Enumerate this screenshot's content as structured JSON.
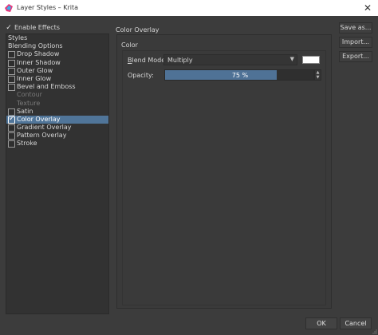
{
  "window": {
    "title": "Layer Styles – Krita",
    "icons": [
      "krita-app-icon",
      "close-icon"
    ]
  },
  "enable_effects": {
    "label": "Enable Effects",
    "checked": true
  },
  "styles_list": {
    "header": "Styles",
    "blending_options": "Blending Options",
    "items": [
      {
        "label": "Drop Shadow",
        "checked": false,
        "selected": false
      },
      {
        "label": "Inner Shadow",
        "checked": false,
        "selected": false
      },
      {
        "label": "Outer Glow",
        "checked": false,
        "selected": false
      },
      {
        "label": "Inner Glow",
        "checked": false,
        "selected": false
      },
      {
        "label": "Bevel and Emboss",
        "checked": false,
        "selected": false
      },
      {
        "label": "Contour",
        "sub": true
      },
      {
        "label": "Texture",
        "sub": true
      },
      {
        "label": "Satin",
        "checked": false,
        "selected": false
      },
      {
        "label": "Color Overlay",
        "checked": true,
        "selected": true
      },
      {
        "label": "Gradient Overlay",
        "checked": false,
        "selected": false
      },
      {
        "label": "Pattern Overlay",
        "checked": false,
        "selected": false
      },
      {
        "label": "Stroke",
        "checked": false,
        "selected": false
      }
    ]
  },
  "panel": {
    "title": "Color Overlay",
    "group_title": "Color",
    "blend_mode_label": "Blend Mode:",
    "blend_mode_value": "Multiply",
    "overlay_color": "#ffffff",
    "opacity_label": "Opacity:",
    "opacity_text": "75 %",
    "opacity_value": 0.75
  },
  "side_buttons": {
    "save_as": "Save as...",
    "import": "Import...",
    "export": "Export..."
  },
  "footer": {
    "ok": "OK",
    "cancel": "Cancel"
  },
  "colors": {
    "selection": "#507599",
    "background": "#3c3c3c"
  }
}
